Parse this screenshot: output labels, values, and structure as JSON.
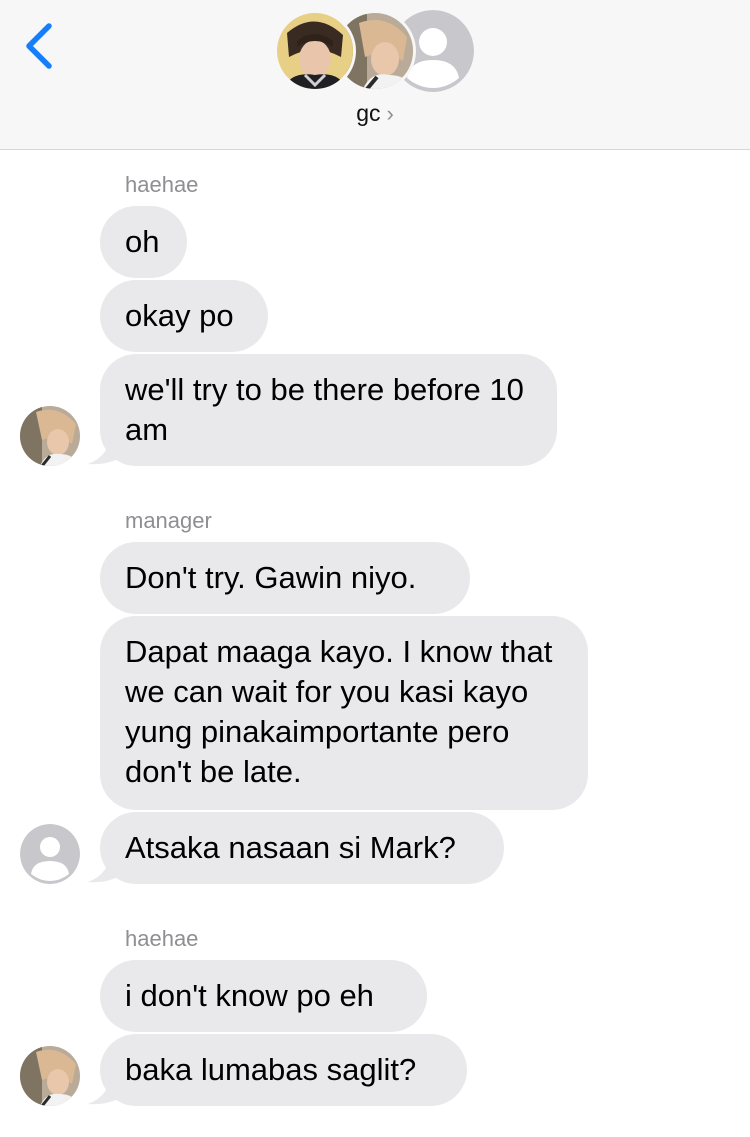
{
  "header": {
    "group_name": "gc",
    "chevron": "›"
  },
  "messages": [
    {
      "sender": "haehae",
      "bubbles": [
        "oh",
        "okay po",
        "we'll try to be there before 10 am"
      ]
    },
    {
      "sender": "manager",
      "bubbles": [
        "Don't try. Gawin niyo.",
        "Dapat maaga kayo. I know that we can wait for you kasi kayo yung pinakaimportante pero don't be late.",
        "Atsaka nasaan si Mark?"
      ]
    },
    {
      "sender": "haehae",
      "bubbles": [
        "i don't know po eh",
        "baka lumabas saglit?"
      ]
    }
  ],
  "colors": {
    "accent": "#147efb",
    "bubble": "#e9e9eb",
    "meta_text": "#8e8e93"
  },
  "icons": [
    "back-chevron-icon",
    "group-avatar-photo-1",
    "group-avatar-photo-2",
    "default-contact-icon",
    "chevron-right-icon"
  ]
}
